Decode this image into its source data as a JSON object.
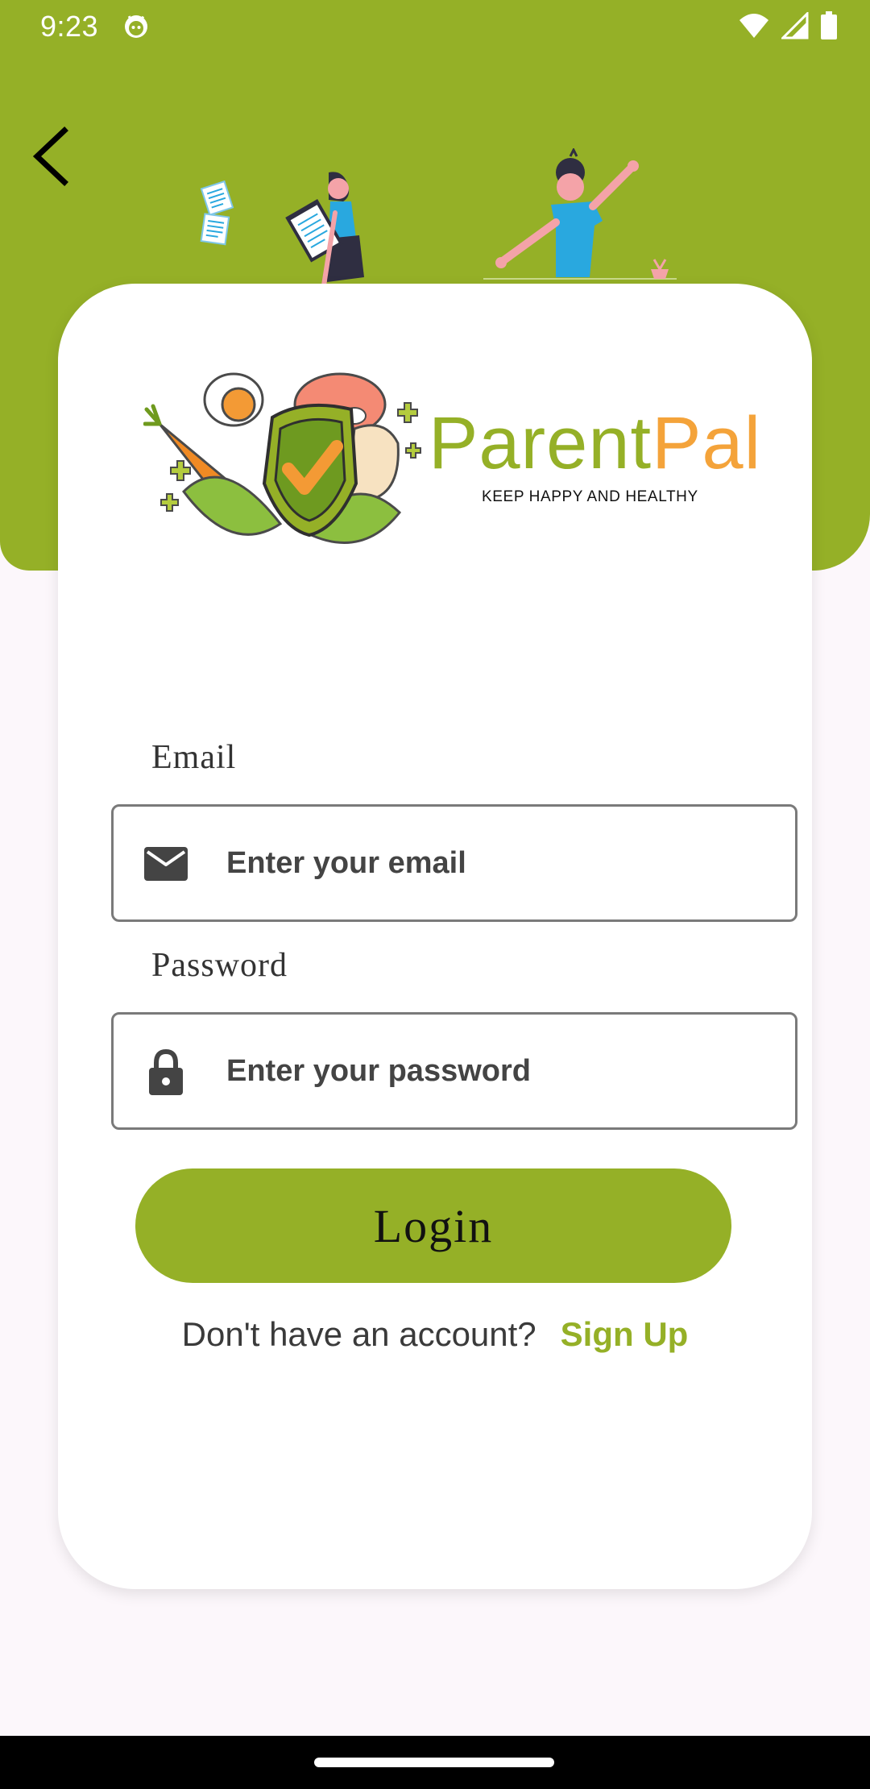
{
  "status_bar": {
    "time": "9:23",
    "icons": [
      "android-app-icon",
      "wifi-icon",
      "cell-signal-icon",
      "battery-icon"
    ]
  },
  "header": {
    "back_icon": "chevron-left-icon"
  },
  "logo": {
    "brand_part1": "Parent",
    "brand_part2": "Pal",
    "tagline": "KEEP HAPPY AND HEALTHY"
  },
  "form": {
    "email": {
      "label": "Email",
      "placeholder": "Enter your email",
      "value": "",
      "icon": "envelope-icon"
    },
    "password": {
      "label": "Password",
      "placeholder": "Enter your password",
      "value": "",
      "icon": "lock-icon"
    },
    "login_label": "Login"
  },
  "signup": {
    "prompt": "Don't have an account?",
    "link": "Sign Up"
  },
  "colors": {
    "accent": "#95b027",
    "logo_orange": "#f4a33a",
    "background": "#fcf7fb",
    "card": "#ffffff"
  }
}
